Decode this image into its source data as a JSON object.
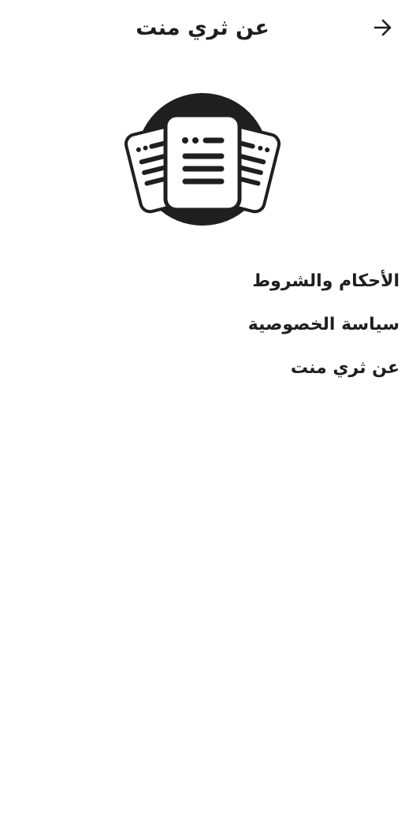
{
  "header": {
    "title": "عن ثري منت",
    "back_icon": "arrow-right-icon"
  },
  "hero": {
    "icon": "documents-icon",
    "circle_color": "#1f1f1f"
  },
  "menu": {
    "items": [
      {
        "label": "الأحكام والشروط"
      },
      {
        "label": "سياسة الخصوصية"
      },
      {
        "label": "عن ثري منت"
      }
    ]
  }
}
